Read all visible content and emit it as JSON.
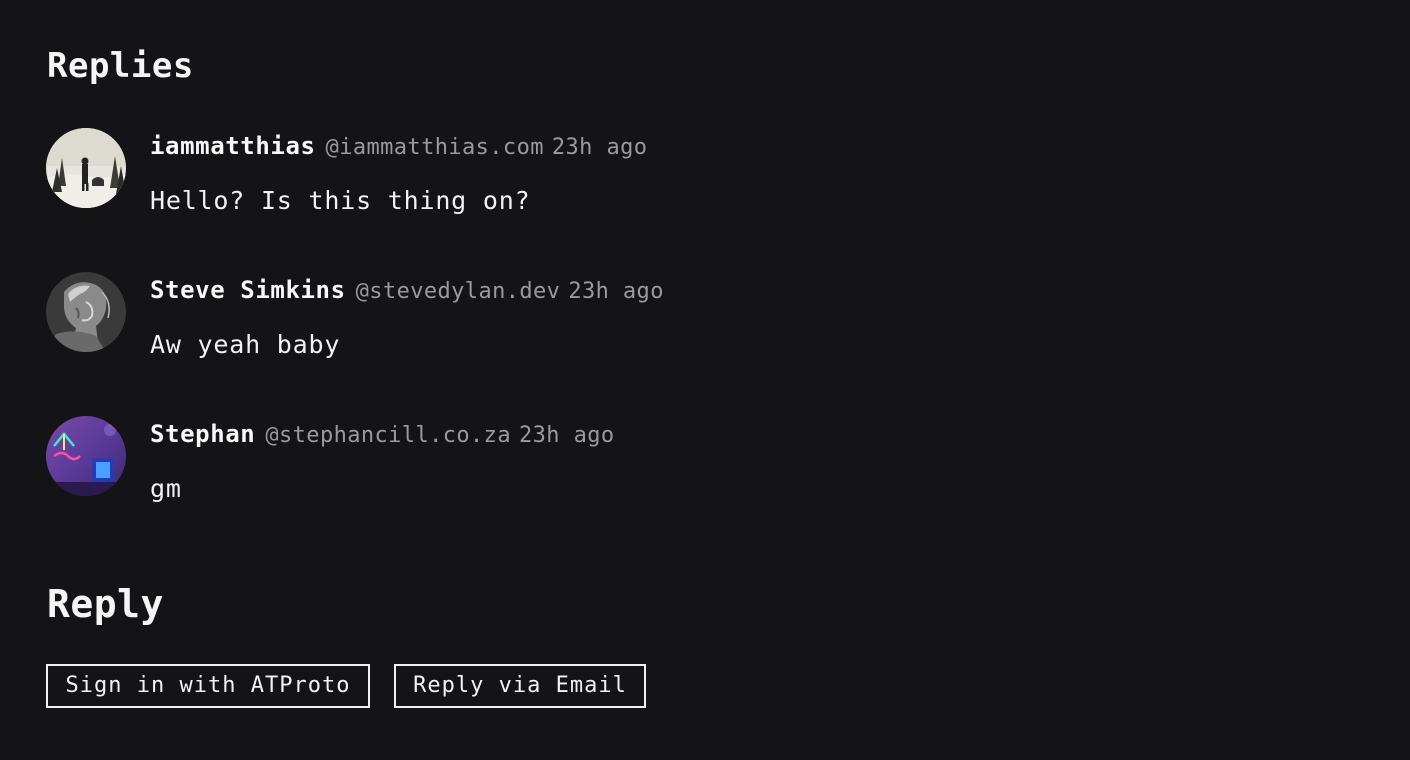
{
  "replies_section": {
    "title": "Replies",
    "comments": [
      {
        "name": "iammatthias",
        "handle": "@iammatthias.com",
        "time": "23h ago",
        "text": "Hello? Is this thing on?",
        "avatar_icon": "photo-snowy-landscape-person"
      },
      {
        "name": "Steve Simkins",
        "handle": "@stevedylan.dev",
        "time": "23h ago",
        "text": "Aw yeah baby",
        "avatar_icon": "photo-statue-bust"
      },
      {
        "name": "Stephan",
        "handle": "@stephancill.co.za",
        "time": "23h ago",
        "text": "gm",
        "avatar_icon": "photo-neon-sign"
      }
    ]
  },
  "reply_section": {
    "title": "Reply",
    "buttons": {
      "atproto": "Sign in with ATProto",
      "email": "Reply via Email"
    }
  },
  "colors": {
    "background": "#141416",
    "text": "#f2f2f2",
    "muted": "#9a9a9e"
  }
}
